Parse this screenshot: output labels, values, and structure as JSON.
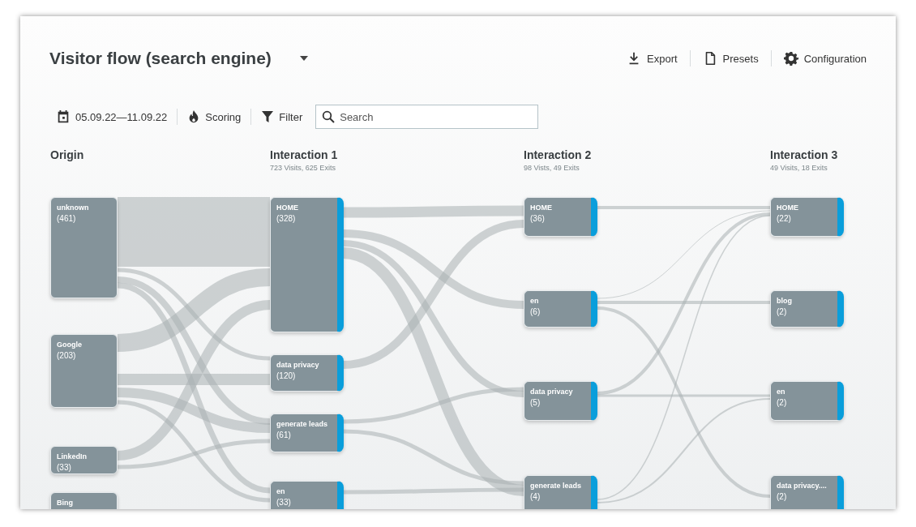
{
  "title": "Visitor flow (search engine)",
  "actions": [
    {
      "kind": "export",
      "label": "Export"
    },
    {
      "kind": "presets",
      "label": "Presets"
    },
    {
      "kind": "configuration",
      "label": "Configuration"
    }
  ],
  "toolbar": {
    "date_range": "05.09.22—11.09.22",
    "scoring": "Scoring",
    "filter": "Filter",
    "search": {
      "placeholder": "Search"
    }
  },
  "columns": [
    {
      "kind": "source",
      "title": "Origin",
      "nodes": [
        {
          "label": "unknown",
          "count": "(461)"
        },
        {
          "label": "Google",
          "count": "(203)"
        },
        {
          "label": "LinkedIn",
          "count": "(33)"
        },
        {
          "label": "Bing"
        }
      ]
    },
    {
      "kind": "interaction",
      "title": "Interaction 1",
      "subtitle": "723 Visits, 625 Exits",
      "nodes": [
        {
          "label": "HOME",
          "count": "(328)"
        },
        {
          "label": "data privacy",
          "count": "(120)"
        },
        {
          "label": "generate leads",
          "count": "(61)"
        },
        {
          "label": "en",
          "count": "(33)"
        }
      ]
    },
    {
      "kind": "interaction",
      "title": "Interaction 2",
      "subtitle": "98 Vists, 49 Exits",
      "nodes": [
        {
          "label": "HOME",
          "count": "(36)"
        },
        {
          "label": "en",
          "count": "(6)"
        },
        {
          "label": "data privacy",
          "count": "(5)"
        },
        {
          "label": "generate leads",
          "count": "(4)"
        }
      ]
    },
    {
      "kind": "interaction",
      "title": "Interaction 3",
      "subtitle": "49 Visits, 18 Exits",
      "nodes": [
        {
          "label": "HOME",
          "count": "(22)"
        },
        {
          "label": "blog",
          "count": "(2)"
        },
        {
          "label": "en",
          "count": "(2)"
        },
        {
          "label": "data privacy....",
          "count": "(2)"
        }
      ]
    }
  ]
}
